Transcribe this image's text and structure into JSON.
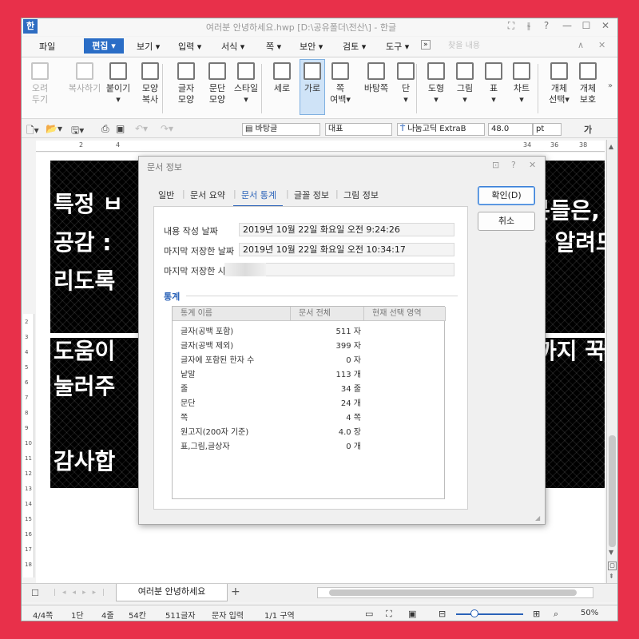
{
  "window": {
    "title": "여러분 안녕하세요.hwp [D:\\공유폴더\\전산\\] - 한글",
    "app_icon_letter": "한",
    "controls": [
      "⛶",
      "⫳",
      "?",
      "—",
      "☐",
      "✕"
    ]
  },
  "menubar": {
    "file": "파일",
    "edit": "편집",
    "items": [
      "보기",
      "입력",
      "서식",
      "쪽",
      "보안",
      "검토",
      "도구"
    ],
    "more": "»",
    "search_placeholder": "찾을 내용",
    "right_controls": [
      "∧",
      "✕"
    ]
  },
  "ribbon": {
    "groups": [
      {
        "label": "오려\n두기",
        "icon": "cut-icon",
        "disabled": true
      },
      {
        "label": "복사하기",
        "icon": "copy-icon",
        "disabled": true
      },
      {
        "label": "붙이기\n▾",
        "icon": "paste-icon"
      },
      {
        "label": "모양\n복사",
        "icon": "format-painter-icon"
      },
      {
        "label": "글자\n모양",
        "icon": "char-shape-icon"
      },
      {
        "label": "문단\n모양",
        "icon": "para-shape-icon"
      },
      {
        "label": "스타일\n▾",
        "icon": "style-icon"
      },
      {
        "label": "세로",
        "icon": "portrait-icon"
      },
      {
        "label": "가로",
        "icon": "landscape-icon",
        "selected": true
      },
      {
        "label": "쪽\n여백▾",
        "icon": "margin-icon"
      },
      {
        "label": "바탕쪽",
        "icon": "master-page-icon"
      },
      {
        "label": "단\n▾",
        "icon": "columns-icon"
      },
      {
        "label": "도형\n▾",
        "icon": "shape-icon"
      },
      {
        "label": "그림\n▾",
        "icon": "picture-icon"
      },
      {
        "label": "표\n▾",
        "icon": "table-icon"
      },
      {
        "label": "차트\n▾",
        "icon": "chart-icon"
      },
      {
        "label": "개체\n선택▾",
        "icon": "select-object-icon"
      },
      {
        "label": "개체\n보호",
        "icon": "object-protect-icon"
      }
    ],
    "overflow": "»"
  },
  "format_toolbar": {
    "style": "바탕글",
    "lang": "대표",
    "font": "나눔고딕 ExtraB",
    "size": "48.0",
    "unit": "pt",
    "bold": "가"
  },
  "ruler": {
    "numbers": [
      "2",
      "4",
      "34",
      "36",
      "38"
    ],
    "vertical_numbers": [
      "2",
      "3",
      "4",
      "5",
      "6",
      "7",
      "8",
      "9",
      "10",
      "11",
      "12",
      "13",
      "14",
      "15",
      "16",
      "17",
      "18"
    ]
  },
  "document": {
    "lines": [
      "특정 ㅂ",
      "공감 :",
      "리도록",
      "도움이",
      "눌러주",
      "감사합"
    ],
    "right_lines": [
      "분들은,",
      "을 알려드",
      "까지 꾹"
    ]
  },
  "dialog": {
    "title": "문서 정보",
    "controls": [
      "⊡",
      "?",
      "✕"
    ],
    "tabs": [
      "일반",
      "문서 요약",
      "문서 통계",
      "글꼴 정보",
      "그림 정보"
    ],
    "active_tab": "문서 통계",
    "fields": [
      {
        "label": "내용 작성 날짜",
        "value": "2019년 10월 22일 화요일 오전 9:24:26"
      },
      {
        "label": "마지막 저장한 날짜",
        "value": "2019년 10월 22일 화요일 오전 10:34:17"
      },
      {
        "label": "마지막 저장한 사",
        "value": ""
      }
    ],
    "section_title": "통계",
    "table": {
      "headers": [
        "통계 이름",
        "문서 전체",
        "현재 선택 영역"
      ],
      "rows": [
        [
          "글자(공백 포함)",
          "511 자"
        ],
        [
          "글자(공백 제외)",
          "399 자"
        ],
        [
          "글자에 포함된 한자 수",
          "0 자"
        ],
        [
          "낱말",
          "113 개"
        ],
        [
          "줄",
          "34 줄"
        ],
        [
          "문단",
          "24 개"
        ],
        [
          "쪽",
          "4 쪽"
        ],
        [
          "원고지(200자 기준)",
          "4.0 장"
        ],
        [
          "표,그림,글상자",
          "0 개"
        ]
      ]
    },
    "ok": "확인(D)",
    "cancel": "취소"
  },
  "tabbar": {
    "doc_tab": "여러분 안녕하세요",
    "add": "+"
  },
  "status": {
    "items": [
      "4/4쪽",
      "1단",
      "4줄",
      "54칸",
      "511글자",
      "문자 입력",
      "1/1 구역"
    ],
    "zoom": "50%"
  }
}
